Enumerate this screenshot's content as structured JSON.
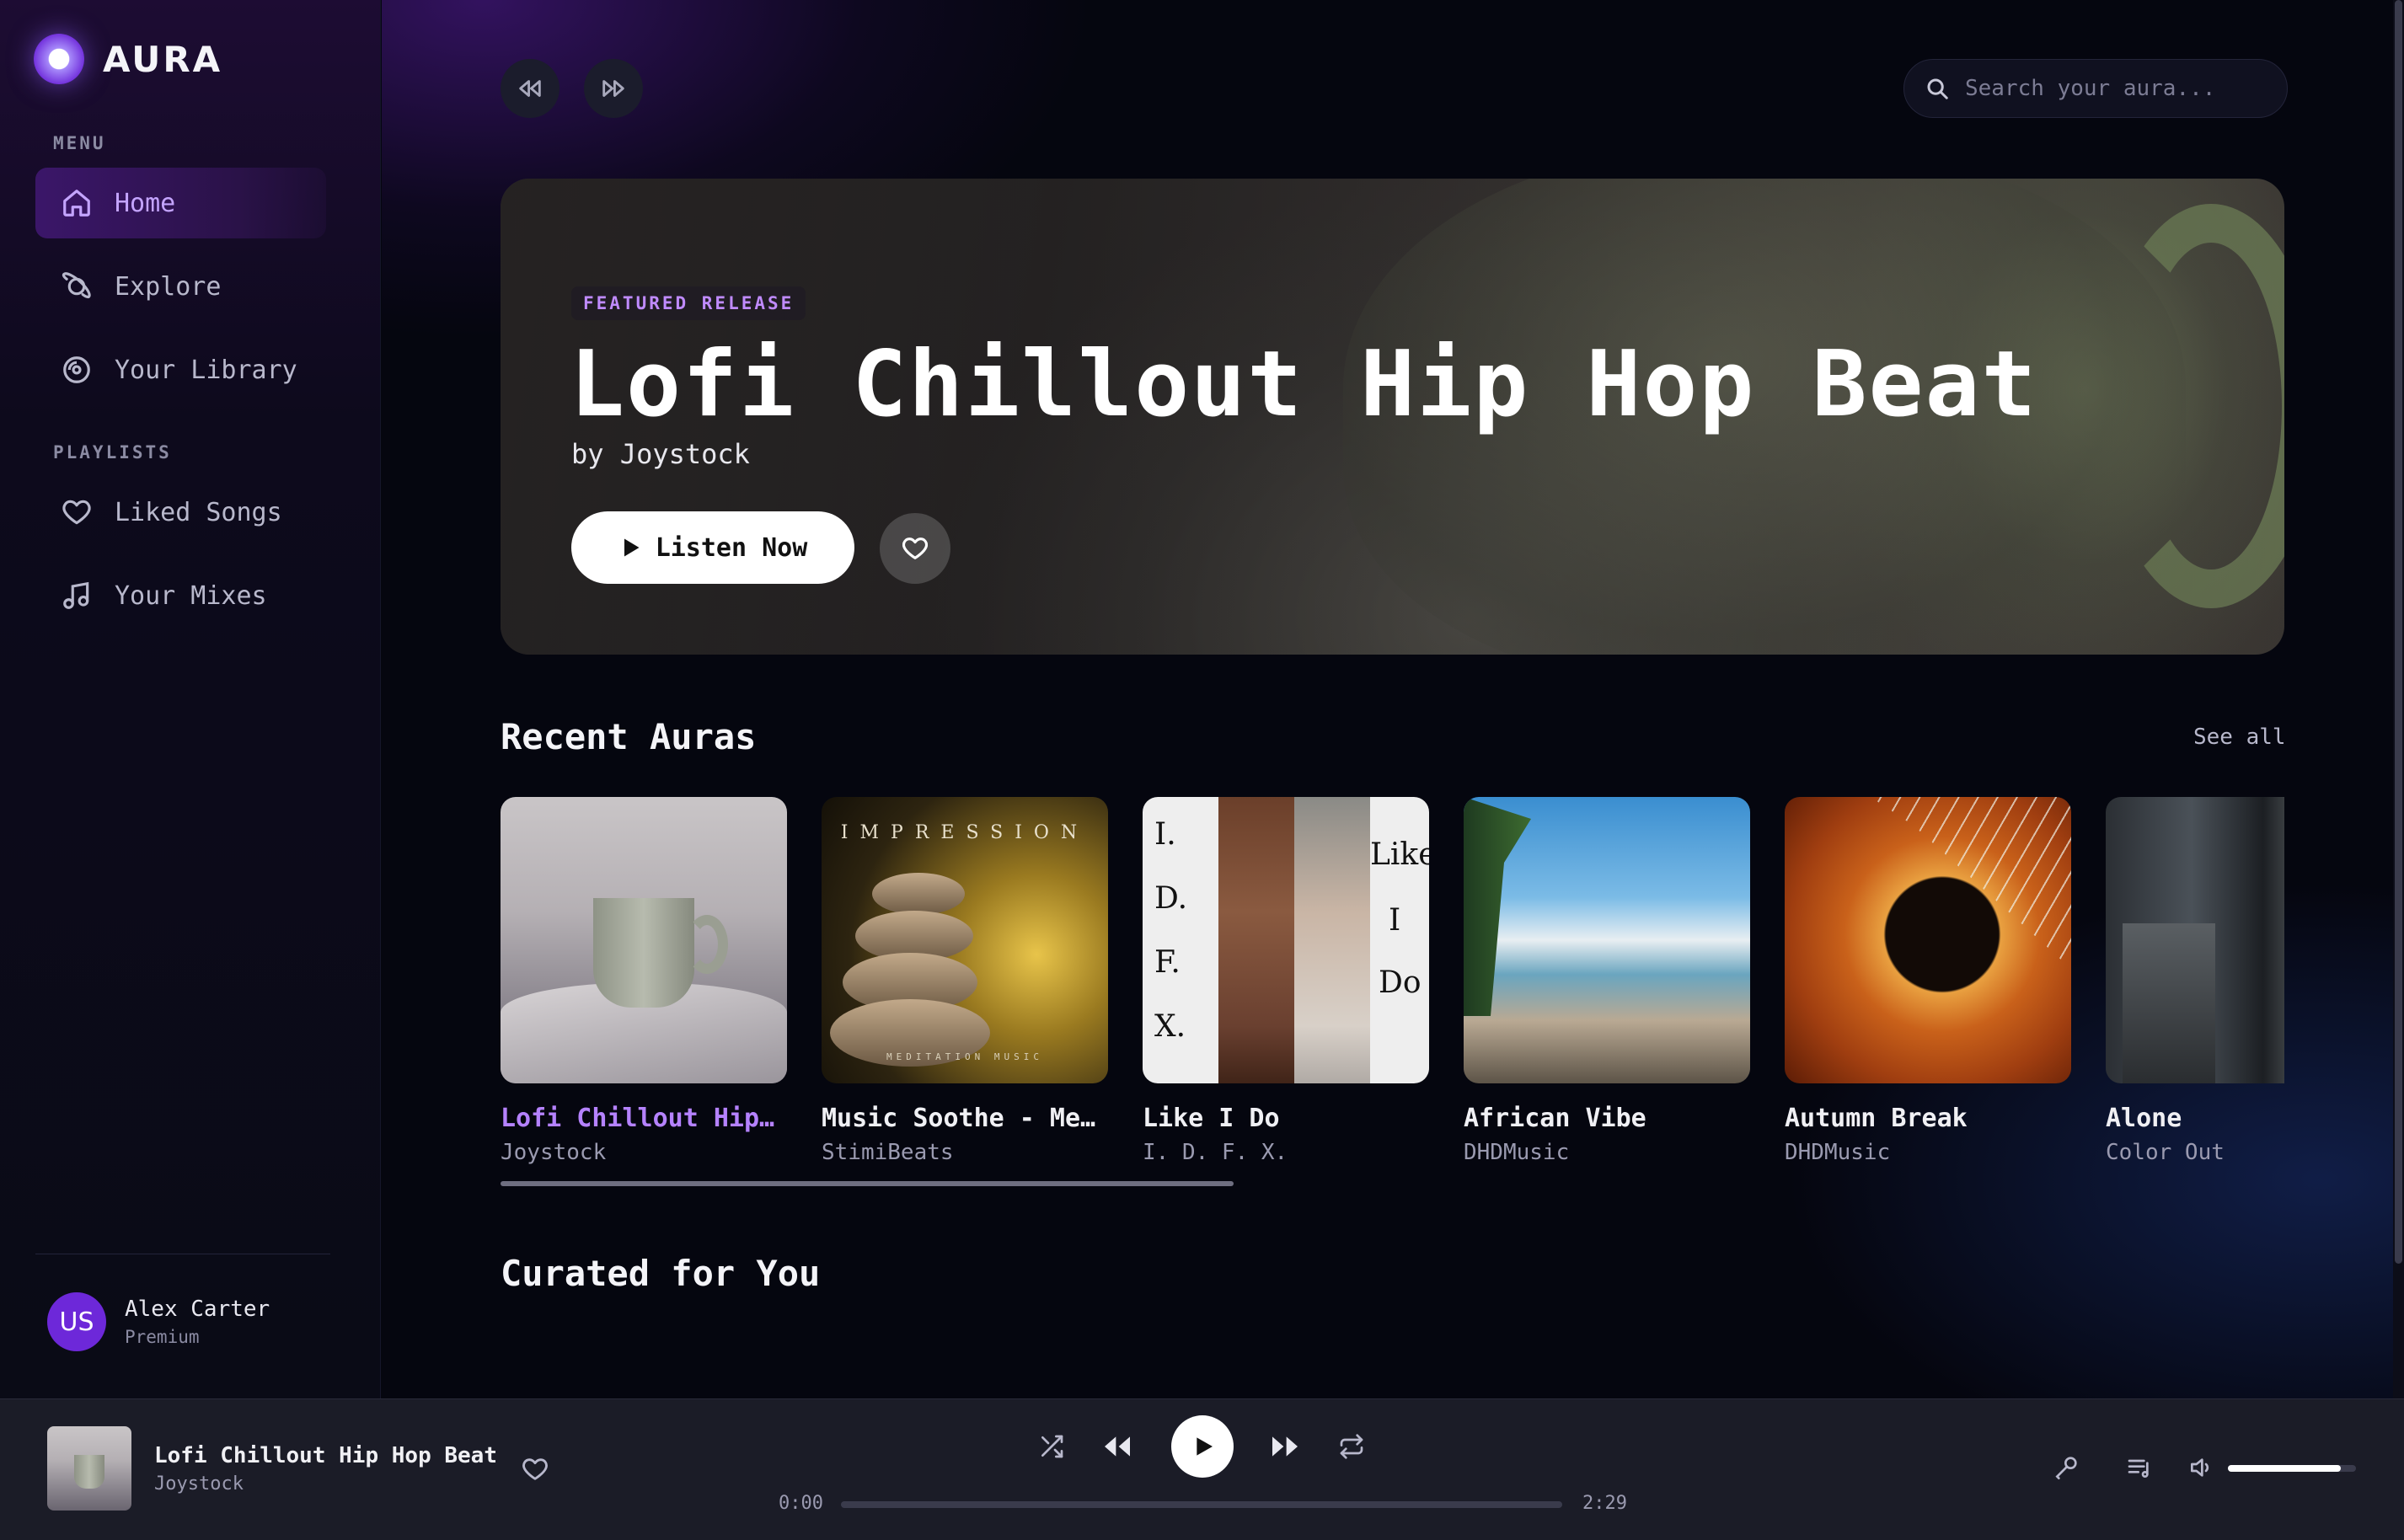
{
  "app": {
    "name": "AURA"
  },
  "sidebar": {
    "menu_label": "MENU",
    "menu_items": [
      {
        "label": "Home",
        "icon": "home-icon",
        "active": true
      },
      {
        "label": "Explore",
        "icon": "planet-icon",
        "active": false
      },
      {
        "label": "Your Library",
        "icon": "disc-icon",
        "active": false
      }
    ],
    "playlists_label": "PLAYLISTS",
    "playlist_items": [
      {
        "label": "Liked Songs",
        "icon": "heart-icon"
      },
      {
        "label": "Your Mixes",
        "icon": "music-note-icon"
      }
    ],
    "user": {
      "initials": "US",
      "name": "Alex Carter",
      "plan": "Premium"
    }
  },
  "header": {
    "search_placeholder": "Search your aura..."
  },
  "hero": {
    "badge": "FEATURED RELEASE",
    "title": "Lofi Chillout Hip Hop Beat",
    "artist": "by Joystock",
    "listen_label": "Listen Now"
  },
  "recent": {
    "title": "Recent Auras",
    "see_all": "See all",
    "items": [
      {
        "title": "Lofi Chillout Hip …",
        "artist": "Joystock",
        "active": true
      },
      {
        "title": "Music Soothe - Med…",
        "artist": "StimiBeats",
        "active": false
      },
      {
        "title": "Like I Do",
        "artist": "I. D. F. X.",
        "active": false
      },
      {
        "title": "African Vibe",
        "artist": "DHDMusic",
        "active": false
      },
      {
        "title": "Autumn Break",
        "artist": "DHDMusic",
        "active": false
      },
      {
        "title": "Alone",
        "artist": "Color Out",
        "active": false
      }
    ],
    "cover_text": {
      "impression": "IMPRESSION",
      "meditation": "MEDITATION MUSIC",
      "idfx": [
        "I.",
        "D.",
        "F.",
        "X."
      ],
      "like_i_do": [
        "Like",
        "I",
        "Do"
      ]
    }
  },
  "curated": {
    "title": "Curated for You"
  },
  "player": {
    "title": "Lofi Chillout Hip Hop Beat",
    "artist": "Joystock",
    "current_time": "0:00",
    "duration": "2:29",
    "progress": 0.0,
    "volume": 0.88
  },
  "colors": {
    "accent": "#b582ff",
    "accent_dark": "#6d28d9",
    "background": "#05060f",
    "player_bg": "#1b1c27"
  }
}
